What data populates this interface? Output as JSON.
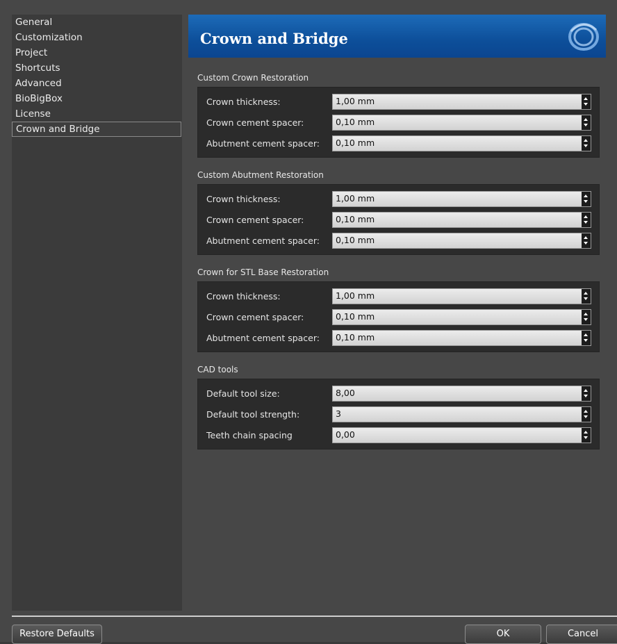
{
  "sidebar": {
    "items": [
      {
        "label": "General"
      },
      {
        "label": "Customization"
      },
      {
        "label": "Project"
      },
      {
        "label": "Shortcuts"
      },
      {
        "label": "Advanced"
      },
      {
        "label": "BioBigBox"
      },
      {
        "label": "License"
      },
      {
        "label": "Crown and Bridge",
        "selected": true
      }
    ]
  },
  "header": {
    "title": "Crown and Bridge",
    "logo_icon": "swirl-logo-icon"
  },
  "groups": [
    {
      "title": "Custom Crown Restoration",
      "rows": [
        {
          "label": "Crown thickness:",
          "value": "1,00 mm"
        },
        {
          "label": "Crown cement spacer:",
          "value": "0,10 mm"
        },
        {
          "label": "Abutment cement spacer:",
          "value": "0,10 mm"
        }
      ]
    },
    {
      "title": "Custom Abutment Restoration",
      "rows": [
        {
          "label": "Crown thickness:",
          "value": "1,00 mm"
        },
        {
          "label": "Crown cement spacer:",
          "value": "0,10 mm"
        },
        {
          "label": "Abutment cement spacer:",
          "value": "0,10 mm"
        }
      ]
    },
    {
      "title": "Crown for STL Base Restoration",
      "rows": [
        {
          "label": "Crown thickness:",
          "value": "1,00 mm"
        },
        {
          "label": "Crown cement spacer:",
          "value": "0,10 mm"
        },
        {
          "label": "Abutment cement spacer:",
          "value": "0,10 mm"
        }
      ]
    },
    {
      "title": "CAD tools",
      "rows": [
        {
          "label": "Default tool size:",
          "value": "8,00"
        },
        {
          "label": "Default tool strength:",
          "value": "3"
        },
        {
          "label": "Teeth chain spacing",
          "value": "0,00"
        }
      ]
    }
  ],
  "footer": {
    "restore_label": "Restore Defaults",
    "ok_label": "OK",
    "cancel_label": "Cancel"
  },
  "colors": {
    "header_blue": "#0d4f9a",
    "window_bg": "#474747",
    "group_bg": "#2b2b2b"
  }
}
